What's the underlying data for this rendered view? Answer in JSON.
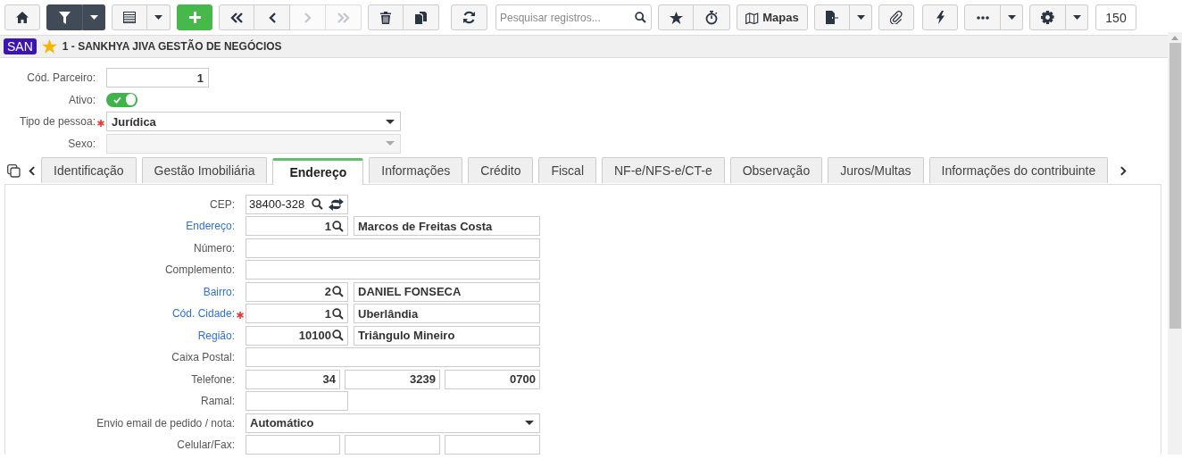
{
  "toolbar": {
    "filter_active": true,
    "nav": [
      {
        "disabled": false
      },
      {
        "disabled": false
      },
      {
        "disabled": true
      },
      {
        "disabled": true
      }
    ],
    "search": {
      "placeholder": "Pesquisar registros..."
    },
    "maps_label": "Mapas",
    "page_size": "150"
  },
  "header": {
    "badge": "SAN",
    "favorite": true,
    "title": "1 - SANKHYA JIVA GESTÃO DE NEGÓCIOS"
  },
  "top_form": [
    {
      "label": "Cód. Parceiro:",
      "kind": "number",
      "value": "1",
      "required": false,
      "disabled": false
    },
    {
      "label": "Ativo:",
      "kind": "toggle",
      "on": true,
      "required": false,
      "disabled": false
    },
    {
      "label": "Tipo de pessoa:",
      "kind": "select",
      "value": "Jurídica",
      "required": true,
      "disabled": false
    },
    {
      "label": "Sexo:",
      "kind": "select",
      "required": false,
      "disabled": true
    }
  ],
  "tabs": [
    {
      "label": "Identificação",
      "selected": false
    },
    {
      "label": "Gestão Imobiliária",
      "selected": false
    },
    {
      "label": "Endereço",
      "selected": true
    },
    {
      "label": "Informações",
      "selected": false
    },
    {
      "label": "Crédito",
      "selected": false
    },
    {
      "label": "Fiscal",
      "selected": false
    },
    {
      "label": "NF-e/NFS-e/CT-e",
      "selected": false
    },
    {
      "label": "Observação",
      "selected": false
    },
    {
      "label": "Juros/Multas",
      "selected": false
    },
    {
      "label": "Informações do contribuinte",
      "selected": false
    }
  ],
  "address_form": [
    {
      "label": "CEP:",
      "kind": "cep",
      "value": "38400-328",
      "link": false,
      "required": false
    },
    {
      "label": "Endereço:",
      "kind": "lookup",
      "code": "1",
      "value": "Marcos de Freitas Costa",
      "link": true,
      "required": false
    },
    {
      "label": "Número:",
      "kind": "text",
      "link": false,
      "required": false
    },
    {
      "label": "Complemento:",
      "kind": "text",
      "link": false,
      "required": false
    },
    {
      "label": "Bairro:",
      "kind": "lookup",
      "code": "2",
      "value": "DANIEL FONSECA",
      "link": true,
      "required": false
    },
    {
      "label": "Cód. Cidade:",
      "kind": "lookup",
      "code": "1",
      "value": "Uberlândia",
      "link": true,
      "required": true
    },
    {
      "label": "Região:",
      "kind": "lookup",
      "code": "10100",
      "value": "Triângulo Mineiro",
      "link": true,
      "required": false
    },
    {
      "label": "Caixa Postal:",
      "kind": "text",
      "link": false,
      "required": false
    },
    {
      "label": "Telefone:",
      "kind": "triple",
      "parts": [
        "34",
        "3239",
        "0700"
      ],
      "link": false,
      "required": false
    },
    {
      "label": "Ramal:",
      "kind": "short",
      "link": false,
      "required": false
    },
    {
      "label": "Envio email de pedido / nota:",
      "kind": "select",
      "value": "Automático",
      "link": false,
      "required": false
    },
    {
      "label": "Celular/Fax:",
      "kind": "triple",
      "link": false,
      "required": false
    }
  ]
}
